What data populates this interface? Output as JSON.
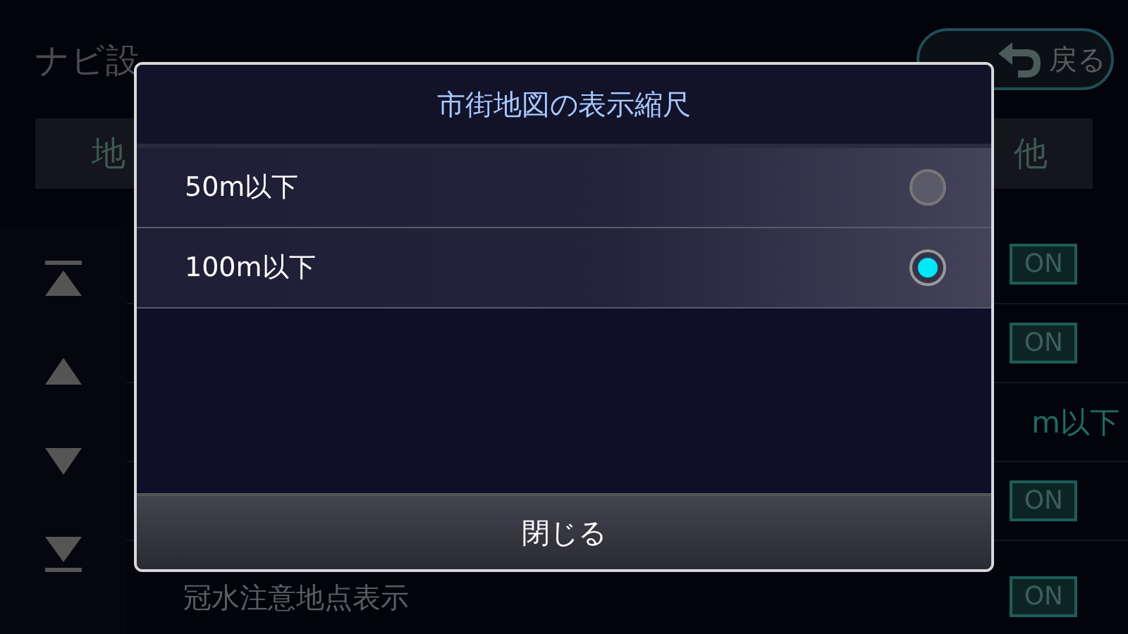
{
  "header": {
    "title": "ナビ設",
    "back_button": "戻る"
  },
  "tabs": [
    {
      "label": "地"
    },
    {
      "label": "他"
    }
  ],
  "settings_rows": [
    {
      "kind": "toggle",
      "value": "ON"
    },
    {
      "kind": "toggle",
      "value": "ON"
    },
    {
      "kind": "text",
      "value": "m以下"
    },
    {
      "kind": "toggle",
      "value": "ON"
    },
    {
      "kind": "toggle",
      "value": "ON",
      "label": "冠水注意地点表示"
    }
  ],
  "dialog": {
    "title": "市街地図の表示縮尺",
    "options": [
      {
        "label": "50m以下",
        "selected": false
      },
      {
        "label": "100m以下",
        "selected": true
      }
    ],
    "close_button": "閉じる"
  }
}
